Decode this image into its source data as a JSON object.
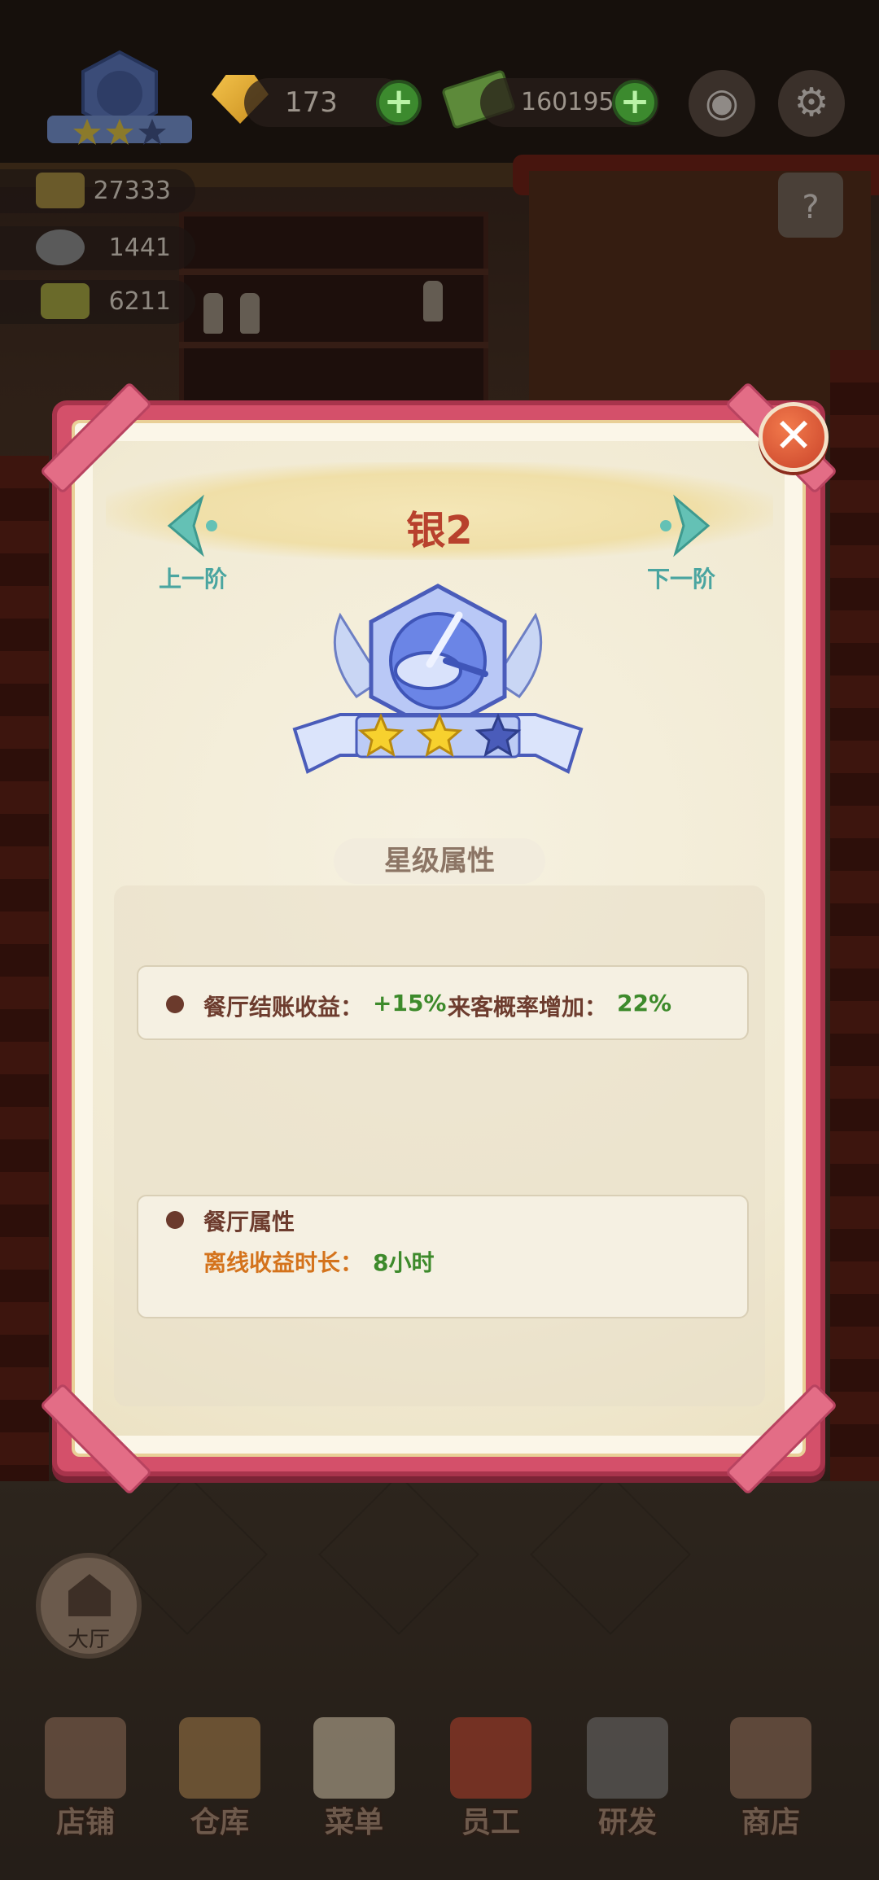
{
  "hud": {
    "gems": "173",
    "cash": "1601957",
    "stats": {
      "customers": "27333",
      "dishes": "1441",
      "tickets": "6211"
    },
    "icons": {
      "rank": "rank-badge-icon",
      "gem": "gem-icon",
      "cash": "cash-icon",
      "camera": "camera-icon",
      "settings": "gear-icon",
      "guide": "guide-book-icon"
    }
  },
  "dialog": {
    "title": "银2",
    "prev_label": "上一阶",
    "next_label": "下一阶",
    "stars_filled": 2,
    "stars_total": 3,
    "section_title": "星级属性",
    "star_attr": {
      "label1": "餐厅结账收益：",
      "value1": "+15%",
      "label2": "来客概率增加：",
      "value2": "22%"
    },
    "restaurant_attr": {
      "title": "餐厅属性",
      "label": "离线收益时长：",
      "value": "8小时"
    },
    "close_icon": "close-icon"
  },
  "hall_button": {
    "label": "大厅"
  },
  "nav": [
    {
      "label": "店铺",
      "icon": "shop-icon"
    },
    {
      "label": "仓库",
      "icon": "warehouse-icon"
    },
    {
      "label": "菜单",
      "icon": "menu-clipboard-icon"
    },
    {
      "label": "员工",
      "icon": "staff-icon"
    },
    {
      "label": "研发",
      "icon": "research-pot-icon"
    },
    {
      "label": "商店",
      "icon": "store-icon"
    }
  ],
  "colors": {
    "frame": "#d4506a",
    "title": "#b8412d",
    "value_green": "#3d8a2b",
    "value_orange": "#d4731c",
    "arrow_teal": "#4aa5a0"
  }
}
